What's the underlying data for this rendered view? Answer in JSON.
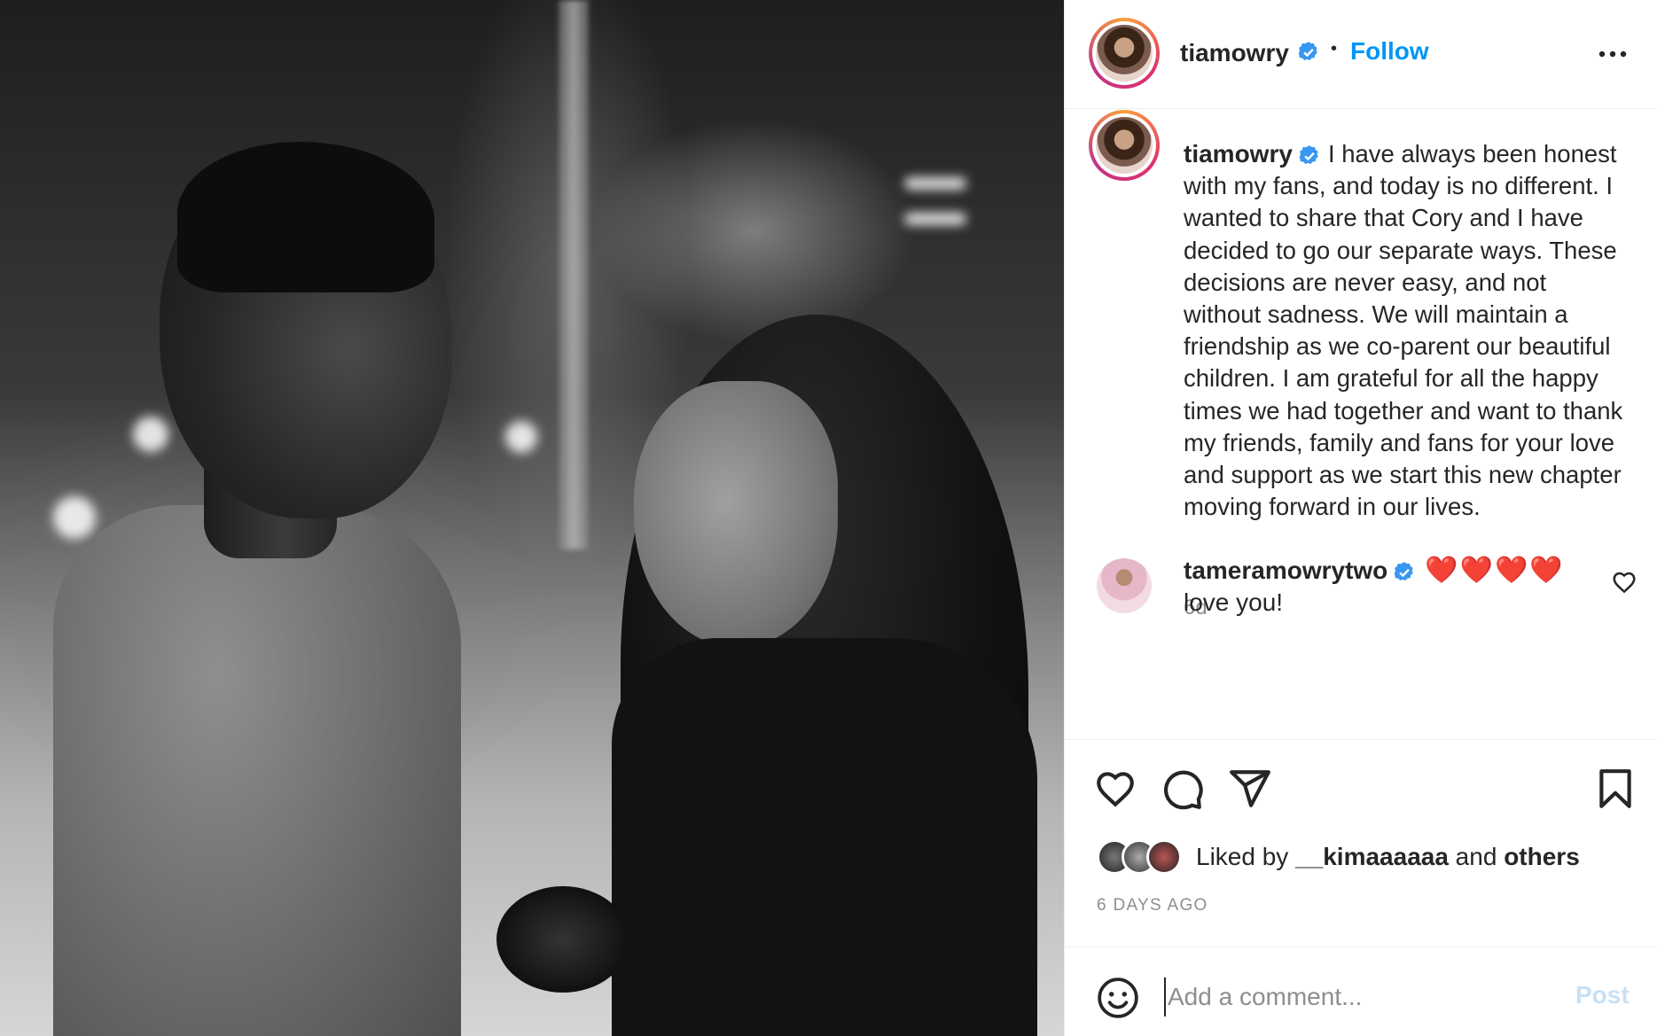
{
  "post": {
    "author": "tiamowry",
    "follow_label": "Follow",
    "separator": "•",
    "caption": "I have always been honest with my fans, and today is no different. I wanted to share that Cory and I have decided to go our separate ways. These decisions are never easy, and not without sadness. We will maintain a friendship as we co-parent our beautiful children. I am grateful for all the happy times we had together and want to thank my friends, family and fans for your love and support as we start this new chapter moving forward in our lives.",
    "caption_age": "6d",
    "date_label": "6 DAYS AGO"
  },
  "comment": {
    "author": "tameramowrytwo",
    "hearts": "❤️❤️❤️❤️",
    "text": "love you!"
  },
  "likes": {
    "prefix": "Liked by ",
    "user": "__kimaaaaaa",
    "middle": " and ",
    "others": "others"
  },
  "composer": {
    "placeholder": "Add a comment...",
    "post_label": "Post"
  },
  "colors": {
    "accent": "#0095f6",
    "verified": "#3897f0",
    "muted": "#8e8e8e",
    "post_disabled": "#c7e0f4"
  },
  "icons": [
    "verified-badge-icon",
    "more-icon",
    "heart-icon",
    "comment-icon",
    "share-icon",
    "bookmark-icon",
    "emoji-icon"
  ]
}
